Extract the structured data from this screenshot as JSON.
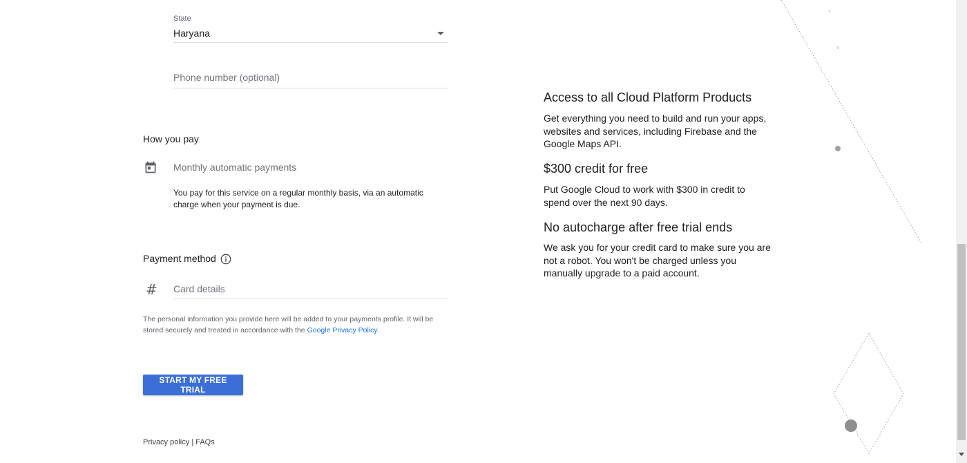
{
  "address": {
    "state_label": "State",
    "state_value": "Haryana",
    "phone_placeholder": "Phone number (optional)"
  },
  "payment_type": {
    "section_title": "How you pay",
    "option_label": "Monthly automatic payments",
    "option_description_line1": "You pay for this service on a regular monthly basis, via an automatic",
    "option_description_line2": "charge when your payment is due."
  },
  "payment_method": {
    "section_title": "Payment method",
    "card_placeholder": "Card details"
  },
  "disclaimer": {
    "line1": "The personal information you provide here will be added to your payments profile. It will be",
    "line2_prefix": "stored securely and treated in accordance with the ",
    "link_text": "Google Privacy Policy",
    "line2_suffix": "."
  },
  "cta": {
    "label": "START MY FREE TRIAL"
  },
  "footer": {
    "privacy_link": "Privacy policy",
    "separator": "|",
    "faqs_link": "FAQs"
  },
  "promo": {
    "items": [
      {
        "title": "Access to all Cloud Platform Products",
        "body": "Get everything you need to build and run your apps, websites and services, including Firebase and the Google Maps API."
      },
      {
        "title": "$300 credit for free",
        "body": "Put Google Cloud to work with $300 in credit to spend over the next 90 days."
      },
      {
        "title": "No autocharge after free trial ends",
        "body": "We ask you for your credit card to make sure you are not a robot. You won't be charged unless you manually upgrade to a paid account."
      }
    ]
  },
  "icons": {
    "calendar": "calendar-icon",
    "info": "info-icon",
    "hash": "#",
    "dropdown": "dropdown-arrow-icon"
  },
  "colors": {
    "primary_button": "#3b6fd6",
    "link": "#1a73e8",
    "text": "#202124",
    "muted": "#5f6368"
  }
}
